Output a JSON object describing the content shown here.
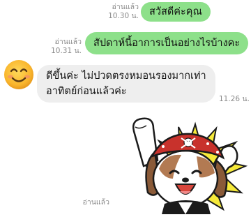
{
  "messages": [
    {
      "direction": "out",
      "read_label": "อ่านแล้ว",
      "time": "10.30 น.",
      "text": "สวัสดีค่ะคุณ"
    },
    {
      "direction": "out",
      "read_label": "อ่านแล้ว",
      "time": "10.31 น.",
      "text": "สัปดาห์นี้อาการเป็นอย่างไรบ้างคะ"
    },
    {
      "direction": "in",
      "avatar": "smiling-face-emoji",
      "text_line1": "ดีขึ้นค่ะ ไม่ปวดตรงหมอนรองมากเท่า",
      "text_line2": "อาทิตย์ก่อนแล้วค่ะ",
      "time": "11.26 น."
    },
    {
      "direction": "out",
      "type": "sticker",
      "sticker": "pirate-dog-cheering-sticker",
      "read_label": "อ่านแล้ว"
    }
  ],
  "colors": {
    "outgoing_bubble": "#8de08a",
    "incoming_bubble": "#eeeeee",
    "meta_text": "#8a8a8a"
  }
}
